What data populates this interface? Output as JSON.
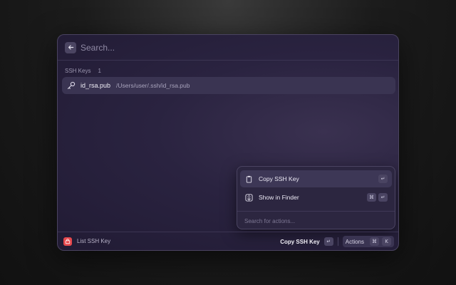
{
  "search": {
    "placeholder": "Search..."
  },
  "section": {
    "title": "SSH Keys",
    "count": "1"
  },
  "list": {
    "items": [
      {
        "title": "id_rsa.pub",
        "subtitle": "/Users/user/.ssh/id_rsa.pub",
        "icon": "key-icon"
      }
    ]
  },
  "actions_panel": {
    "items": [
      {
        "label": "Copy SSH Key",
        "icon": "clipboard-icon",
        "shortcut": [
          "↵"
        ]
      },
      {
        "label": "Show in Finder",
        "icon": "finder-icon",
        "shortcut": [
          "⌘",
          "↵"
        ]
      }
    ],
    "search_placeholder": "Search for actions..."
  },
  "footer": {
    "title": "List SSH Key",
    "primary_action": "Copy SSH Key",
    "primary_shortcut": "↵",
    "actions_label": "Actions",
    "actions_shortcut": [
      "⌘",
      "K"
    ]
  },
  "colors": {
    "accent": "#e5484d",
    "window_bg": "#2a2340",
    "selected_bg": "#3a3452"
  }
}
